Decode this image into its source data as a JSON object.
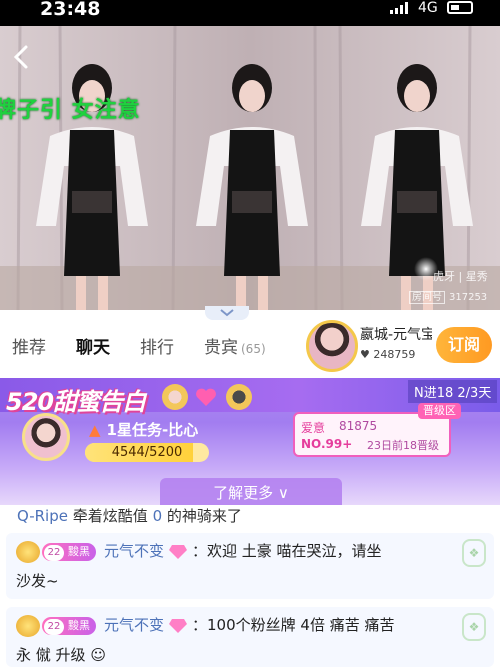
{
  "status_bar": {
    "time": "23:48",
    "network": "4G"
  },
  "video": {
    "overlay_text": "牌子引 女注意",
    "platform_logo": "虎牙 | 星秀",
    "room_label": "房间号",
    "room_number": "317253"
  },
  "tabs": [
    {
      "label": "推荐"
    },
    {
      "label": "聊天",
      "active": true
    },
    {
      "label": "排行"
    },
    {
      "label": "贵宾",
      "count": "(65)"
    }
  ],
  "anchor": {
    "name": "嬴城-元气宝",
    "heat": "248759",
    "subscribe_label": "订阅"
  },
  "event_banner": {
    "title": "520甜蜜告白",
    "entry_text": "N进18 2/3天",
    "task": "1星任务-比心",
    "progress_text": "4544/5200",
    "progress_fraction": 0.874,
    "rank_badge": "晋级区",
    "rank_label": "爱意",
    "rank_score": "81875",
    "rank_position": "NO.99+",
    "rank_info": "23日前18晋级",
    "learn_more": "了解更多"
  },
  "chat": {
    "system_message": {
      "user": "Q-Ripe",
      "text_a": "牵着炫酷值",
      "value": "0",
      "text_b": "的神骑来了"
    },
    "messages": [
      {
        "fan_level": "22",
        "fan_badge": "黢黑",
        "username": "元气不变",
        "line1": "：欢迎  土豪  喵在哭泣，请坐",
        "line2": "沙发~"
      },
      {
        "fan_level": "22",
        "fan_badge": "黢黑",
        "username": "元气不变",
        "line1": "：100个粉丝牌  4倍  痛苦  痛苦",
        "line2": "永  僦  升级"
      }
    ]
  },
  "colors": {
    "accent": "#ff9a22",
    "banner": "#a27df0",
    "username": "#4d72b8",
    "rank_pink": "#e53d9c"
  }
}
